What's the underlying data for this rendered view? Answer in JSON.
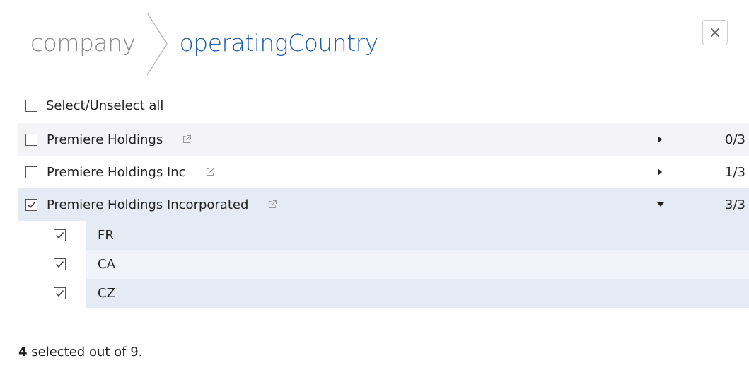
{
  "breadcrumb": {
    "parent": "company",
    "current": "operatingCountry"
  },
  "select_all": {
    "label": "Select/Unselect all",
    "checked": false
  },
  "groups": [
    {
      "label": "Premiere Holdings",
      "count": "0/3",
      "checked": false,
      "expanded": false
    },
    {
      "label": "Premiere Holdings Inc",
      "count": "1/3",
      "checked": false,
      "expanded": false
    },
    {
      "label": "Premiere Holdings Incorporated",
      "count": "3/3",
      "checked": true,
      "expanded": true,
      "children": [
        {
          "label": "FR",
          "checked": true
        },
        {
          "label": "CA",
          "checked": true
        },
        {
          "label": "CZ",
          "checked": true
        }
      ]
    }
  ],
  "summary": {
    "selected": "4",
    "text": " selected out of 9."
  },
  "colors": {
    "accent": "#1f5fa8",
    "expanded_row": "#e5ebf5",
    "alt_row": "#f4f4f6"
  }
}
